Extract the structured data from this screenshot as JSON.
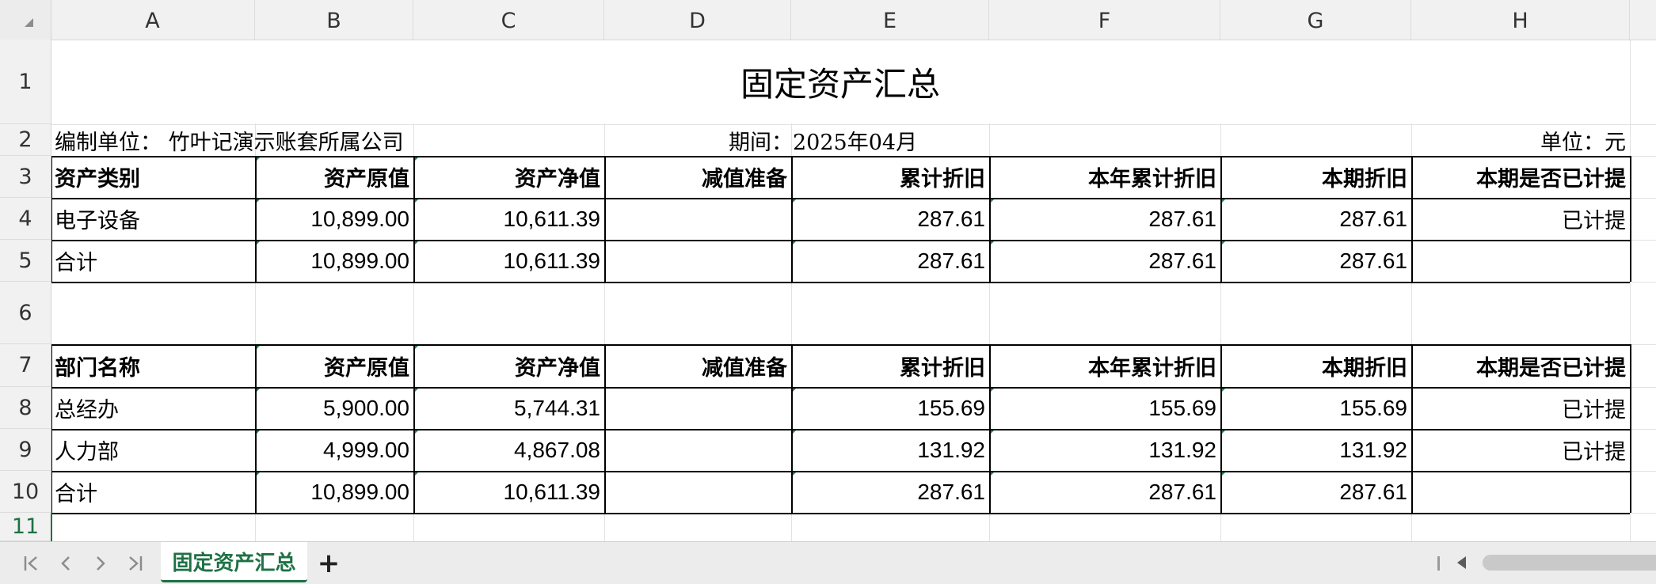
{
  "columns": [
    "A",
    "B",
    "C",
    "D",
    "E",
    "F",
    "G",
    "H"
  ],
  "rows": [
    "1",
    "2",
    "3",
    "4",
    "5",
    "6",
    "7",
    "8",
    "9",
    "10",
    "11"
  ],
  "title": "固定资产汇总",
  "info": {
    "company": "编制单位： 竹叶记演示账套所属公司",
    "period": "期间：2025年04月",
    "unit": "单位：元"
  },
  "table1": {
    "headers": [
      "资产类别",
      "资产原值",
      "资产净值",
      "减值准备",
      "累计折旧",
      "本年累计折旧",
      "本期折旧",
      "本期是否已计提"
    ],
    "rows": [
      [
        "电子设备",
        "10,899.00",
        "10,611.39",
        "",
        "287.61",
        "287.61",
        "287.61",
        "已计提"
      ],
      [
        "合计",
        "10,899.00",
        "10,611.39",
        "",
        "287.61",
        "287.61",
        "287.61",
        ""
      ]
    ]
  },
  "table2": {
    "headers": [
      "部门名称",
      "资产原值",
      "资产净值",
      "减值准备",
      "累计折旧",
      "本年累计折旧",
      "本期折旧",
      "本期是否已计提"
    ],
    "rows": [
      [
        "总经办",
        "5,900.00",
        "5,744.31",
        "",
        "155.69",
        "155.69",
        "155.69",
        "已计提"
      ],
      [
        "人力部",
        "4,999.00",
        "4,867.08",
        "",
        "131.92",
        "131.92",
        "131.92",
        "已计提"
      ],
      [
        "合计",
        "10,899.00",
        "10,611.39",
        "",
        "287.61",
        "287.61",
        "287.61",
        ""
      ]
    ]
  },
  "sheet_bar": {
    "active_tab": "固定资产汇总",
    "add_label": "+",
    "nav": {
      "first": "⏮",
      "prev": "‹",
      "next": "›",
      "last": "⏭"
    }
  },
  "colors": {
    "accent": "#1e7145",
    "grid": "#e2e2e2",
    "header_bg": "#f1f1f1"
  }
}
